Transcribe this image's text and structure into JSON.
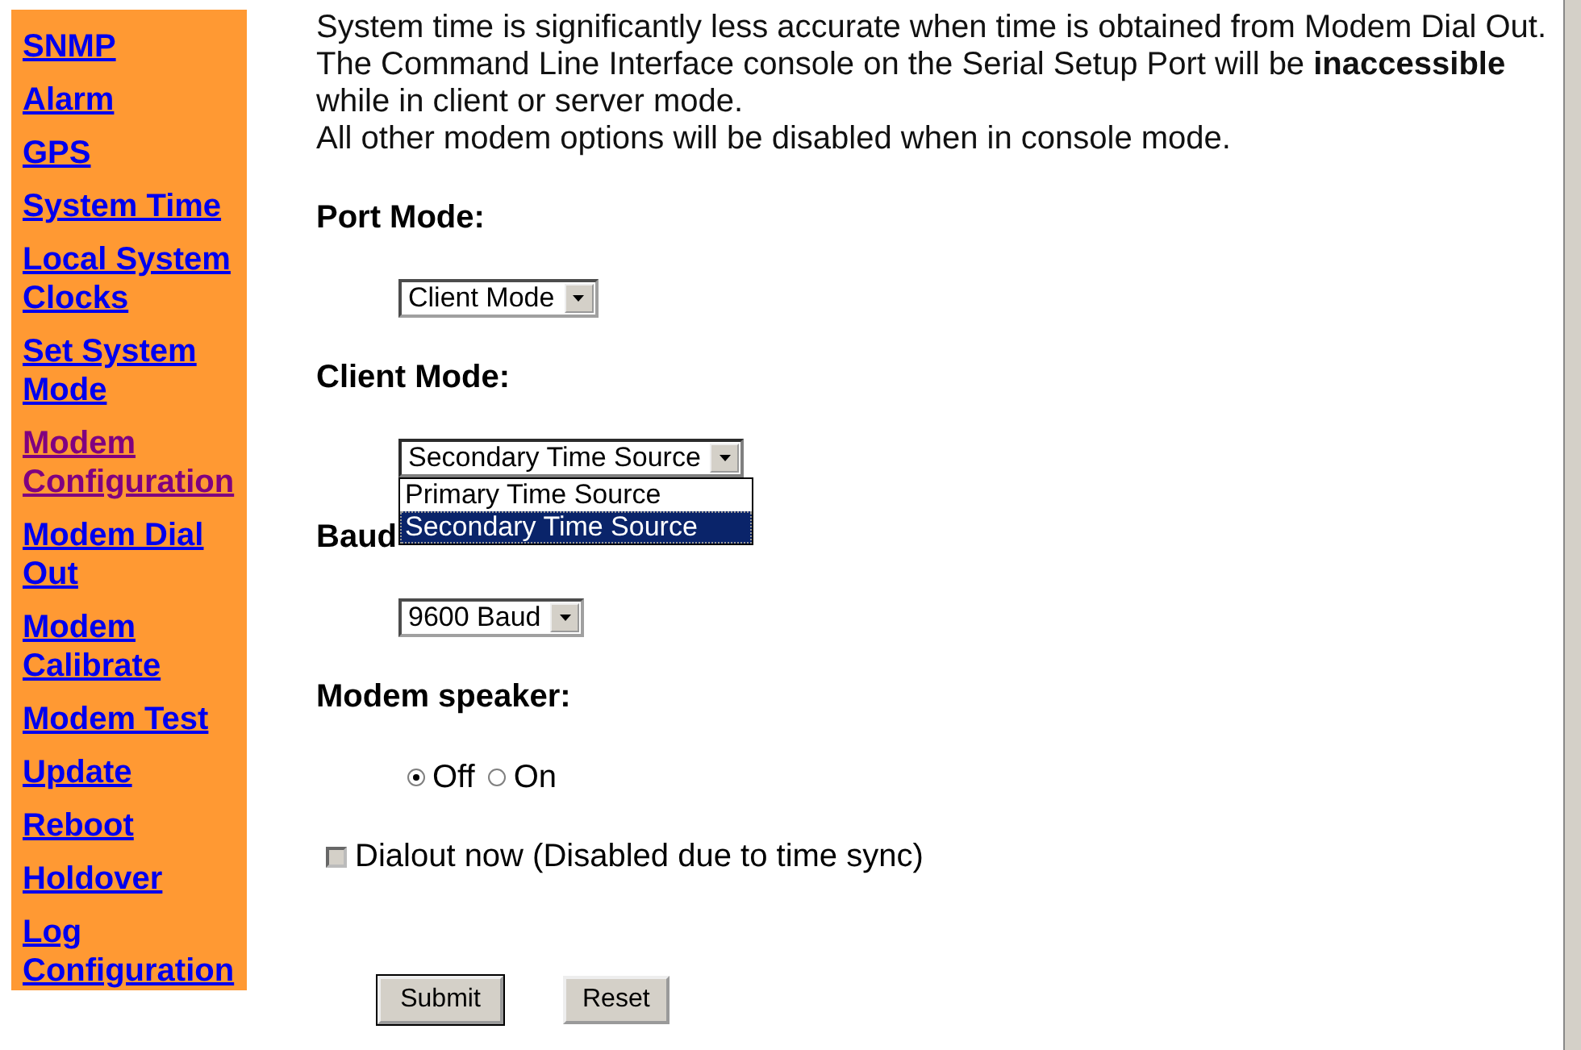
{
  "sidebar": {
    "items": [
      {
        "label": "SNMP",
        "selected": false
      },
      {
        "label": "Alarm",
        "selected": false
      },
      {
        "label": "GPS",
        "selected": false
      },
      {
        "label": "System Time",
        "selected": false
      },
      {
        "label": "Local System Clocks",
        "selected": false
      },
      {
        "label": "Set System Mode",
        "selected": false
      },
      {
        "label": "Modem Configuration",
        "selected": true
      },
      {
        "label": "Modem Dial Out",
        "selected": false
      },
      {
        "label": "Modem Calibrate",
        "selected": false
      },
      {
        "label": "Modem Test",
        "selected": false
      },
      {
        "label": "Update",
        "selected": false
      },
      {
        "label": "Reboot",
        "selected": false
      },
      {
        "label": "Holdover",
        "selected": false
      },
      {
        "label": "Log Configuration",
        "selected": false
      }
    ]
  },
  "notice": [
    "System time is significantly less accurate when time is obtained from Modem Dial Out.",
    "The Command Line Interface console on the Serial Setup Port will be **inaccessible** while in client or server mode.",
    "All other modem options will be disabled when in console mode."
  ],
  "fields": [
    {
      "kind": "select",
      "label": "Port Mode:",
      "value": "Client Mode"
    },
    {
      "kind": "select",
      "label": "Client Mode:",
      "value": "Secondary Time Source",
      "expanded": true,
      "options": [
        {
          "label": "Primary Time Source",
          "selected": false
        },
        {
          "label": "Secondary Time Source",
          "selected": true
        }
      ]
    },
    {
      "kind": "select",
      "label": "Baud",
      "value": "9600 Baud"
    },
    {
      "kind": "radio",
      "label": "Modem speaker:",
      "options": [
        {
          "label": "Off",
          "selected": true
        },
        {
          "label": "On",
          "selected": false
        }
      ]
    },
    {
      "kind": "checkbox",
      "label": "Dialout now (Disabled due to time sync)",
      "checked": false,
      "disabled": true
    }
  ],
  "buttons": [
    {
      "label": "Submit",
      "default": true
    },
    {
      "label": "Reset",
      "default": false
    }
  ]
}
